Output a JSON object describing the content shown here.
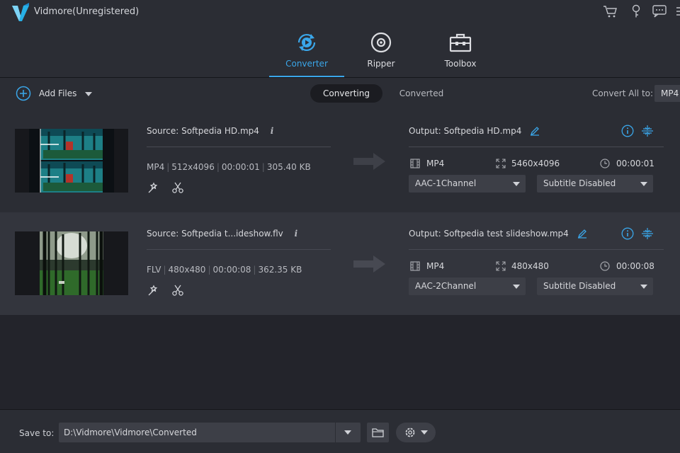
{
  "app": {
    "title": "Vidmore(Unregistered)"
  },
  "header_icons": [
    "cart-icon",
    "key-icon",
    "feedback-icon",
    "menu-icon"
  ],
  "nav": {
    "tabs": [
      {
        "label": "Converter",
        "icon": "converter-icon",
        "active": true
      },
      {
        "label": "Ripper",
        "icon": "disc-icon",
        "active": false
      },
      {
        "label": "Toolbox",
        "icon": "toolbox-icon",
        "active": false
      }
    ]
  },
  "toolbar": {
    "add_files_label": "Add Files",
    "segments": [
      "Converting",
      "Converted"
    ],
    "convert_all_label": "Convert All to:",
    "convert_all_value": "MP4"
  },
  "files": [
    {
      "source": "Source: Softpedia HD.mp4",
      "format": "MP4",
      "resolution": "512x4096",
      "duration": "00:00:01",
      "size": "305.40 KB",
      "output": "Output: Softpedia HD.mp4",
      "out_format": "MP4",
      "out_resolution": "5460x4096",
      "out_duration": "00:00:01",
      "audio": "AAC-1Channel",
      "subtitle": "Subtitle Disabled"
    },
    {
      "source": "Source: Softpedia t...ideshow.flv",
      "format": "FLV",
      "resolution": "480x480",
      "duration": "00:00:08",
      "size": "362.35 KB",
      "output": "Output: Softpedia test slideshow.mp4",
      "out_format": "MP4",
      "out_resolution": "480x480",
      "out_duration": "00:00:08",
      "audio": "AAC-2Channel",
      "subtitle": "Subtitle Disabled"
    }
  ],
  "footer": {
    "save_label": "Save to:",
    "save_path": "D:\\Vidmore\\Vidmore\\Converted"
  },
  "colors": {
    "accent": "#3aa6e9",
    "background": "#23242b",
    "panel": "#2b2d34"
  }
}
